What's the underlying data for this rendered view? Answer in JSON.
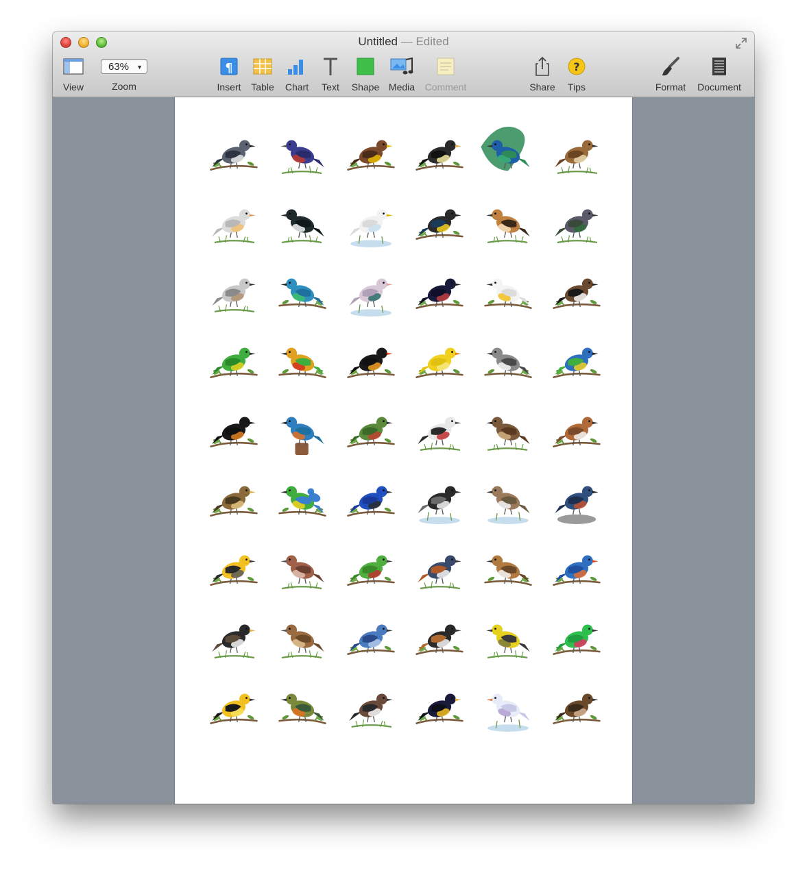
{
  "window": {
    "title": "Untitled",
    "title_status": "— Edited"
  },
  "toolbar": {
    "view_label": "View",
    "zoom_value": "63%",
    "zoom_label": "Zoom",
    "insert_label": "Insert",
    "table_label": "Table",
    "chart_label": "Chart",
    "text_label": "Text",
    "shape_label": "Shape",
    "media_label": "Media",
    "comment_label": "Comment",
    "share_label": "Share",
    "tips_label": "Tips",
    "format_label": "Format",
    "document_label": "Document"
  },
  "colors": {
    "canvas_background": "#8a929c",
    "accent_blue": "#3a8ee6",
    "table_yellow": "#f3c24a",
    "shape_green": "#3fbf4a",
    "tips_yellow": "#f5c518"
  },
  "birds": [
    {
      "body": "#5a6270",
      "wing": "#2d3340",
      "accent": "#e8e8e8",
      "beak": "#222",
      "perch": "branch"
    },
    {
      "body": "#3b3d8f",
      "wing": "#2a2b6a",
      "accent": "#c0392b",
      "beak": "#555",
      "perch": "ground"
    },
    {
      "body": "#7a4a2a",
      "wing": "#4a2c18",
      "accent": "#e6b800",
      "beak": "#e6b800",
      "perch": "branch"
    },
    {
      "body": "#2b2b2b",
      "wing": "#111111",
      "accent": "#f2e6a0",
      "beak": "#e0b040",
      "perch": "branch"
    },
    {
      "body": "#1e5fa8",
      "wing": "#2e8b57",
      "accent": "#3cb371",
      "beak": "#333",
      "perch": "peacock"
    },
    {
      "body": "#9a6b3a",
      "wing": "#6b4422",
      "accent": "#e8d8b0",
      "beak": "#333",
      "perch": "ground"
    },
    {
      "body": "#dcdcdc",
      "wing": "#b8b8b8",
      "accent": "#f0c070",
      "beak": "#e0a060",
      "perch": "ground"
    },
    {
      "body": "#1f2a2a",
      "wing": "#0f1818",
      "accent": "#f4f4f4",
      "beak": "#222",
      "perch": "grass"
    },
    {
      "body": "#f2f2f2",
      "wing": "#dadada",
      "accent": "#c8e0f0",
      "beak": "#e6b800",
      "perch": "water"
    },
    {
      "body": "#2a2a2a",
      "wing": "#1a3a5a",
      "accent": "#f2d020",
      "beak": "#222",
      "perch": "branch"
    },
    {
      "body": "#c08040",
      "wing": "#3a2a1a",
      "accent": "#f4e0c0",
      "beak": "#333",
      "perch": "grass"
    },
    {
      "body": "#5a5a6a",
      "wing": "#3a4a3a",
      "accent": "#2e6b3a",
      "beak": "#333",
      "perch": "ground"
    },
    {
      "body": "#c8c8c8",
      "wing": "#8a8a8a",
      "accent": "#b09070",
      "beak": "#333",
      "perch": "ground"
    },
    {
      "body": "#2f8fbf",
      "wing": "#1f6f9f",
      "accent": "#3cbf6a",
      "beak": "#222",
      "perch": "branch"
    },
    {
      "body": "#d8c8d8",
      "wing": "#b0a0b8",
      "accent": "#2f6f6a",
      "beak": "#e0a0a0",
      "perch": "water"
    },
    {
      "body": "#1a1a3a",
      "wing": "#0f0f2a",
      "accent": "#c04040",
      "beak": "#222",
      "perch": "branch"
    },
    {
      "body": "#f4f4f4",
      "wing": "#dcdcdc",
      "accent": "#f2c020",
      "beak": "#333",
      "perch": "branch"
    },
    {
      "body": "#6a4a30",
      "wing": "#1a1a1a",
      "accent": "#f4f4f4",
      "beak": "#222",
      "perch": "branch"
    },
    {
      "body": "#3fae3f",
      "wing": "#2a8a2a",
      "accent": "#e6d020",
      "beak": "#333",
      "perch": "branch"
    },
    {
      "body": "#e0a020",
      "wing": "#3fae3f",
      "accent": "#d03020",
      "beak": "#333",
      "perch": "branch"
    },
    {
      "body": "#1a1a1a",
      "wing": "#111111",
      "accent": "#f2a020",
      "beak": "#e04020",
      "perch": "branch"
    },
    {
      "body": "#f2d020",
      "wing": "#e0c010",
      "accent": "#f4e880",
      "beak": "#e08020",
      "perch": "branch"
    },
    {
      "body": "#8a8a8a",
      "wing": "#4a4a4a",
      "accent": "#f4f4f4",
      "beak": "#333",
      "perch": "branch"
    },
    {
      "body": "#2f6fbf",
      "wing": "#3fae3f",
      "accent": "#f2d020",
      "beak": "#222",
      "perch": "branch"
    },
    {
      "body": "#1a1a1a",
      "wing": "#111111",
      "accent": "#e08020",
      "beak": "#222",
      "perch": "branch"
    },
    {
      "body": "#2f7fbf",
      "wing": "#1f6fa0",
      "accent": "#e07020",
      "beak": "#222",
      "perch": "stump"
    },
    {
      "body": "#5a8a3a",
      "wing": "#3a6a2a",
      "accent": "#c04030",
      "beak": "#333",
      "perch": "branch"
    },
    {
      "body": "#e8e8e8",
      "wing": "#2a2a2a",
      "accent": "#c03030",
      "beak": "#555",
      "perch": "grass"
    },
    {
      "body": "#7a5a3a",
      "wing": "#5a3a20",
      "accent": "#d0b080",
      "beak": "#222",
      "perch": "ground"
    },
    {
      "body": "#b06a3a",
      "wing": "#7a4a2a",
      "accent": "#f4f4f4",
      "beak": "#333",
      "perch": "branch"
    },
    {
      "body": "#8a6a3a",
      "wing": "#4a3a20",
      "accent": "#e0c080",
      "beak": "#e0b040",
      "perch": "branch"
    },
    {
      "body": "#3fae3f",
      "wing": "#3a7fd0",
      "accent": "#f2d020",
      "beak": "#333",
      "perch": "pair"
    },
    {
      "body": "#1f4fbf",
      "wing": "#1a3a9a",
      "accent": "#2a2a2a",
      "beak": "#333",
      "perch": "branch"
    },
    {
      "body": "#2a2a2a",
      "wing": "#6a6a6a",
      "accent": "#f4f4f4",
      "beak": "#333",
      "perch": "water"
    },
    {
      "body": "#9a7a5a",
      "wing": "#6a5a40",
      "accent": "#f4f4f4",
      "beak": "#333",
      "perch": "water"
    },
    {
      "body": "#2f4f7f",
      "wing": "#1f2f4f",
      "accent": "#c05030",
      "beak": "#222",
      "perch": "rock"
    },
    {
      "body": "#f2c020",
      "wing": "#2a2a2a",
      "accent": "#5a5a5a",
      "beak": "#333",
      "perch": "branch"
    },
    {
      "body": "#a0604a",
      "wing": "#6a4030",
      "accent": "#e0c0b0",
      "beak": "#555",
      "perch": "ground"
    },
    {
      "body": "#4fae3f",
      "wing": "#3a8a2a",
      "accent": "#c03030",
      "beak": "#333",
      "perch": "branch"
    },
    {
      "body": "#3a4a6a",
      "wing": "#b05a2a",
      "accent": "#f4f4f4",
      "beak": "#333",
      "perch": "grass"
    },
    {
      "body": "#b07a40",
      "wing": "#6a4a2a",
      "accent": "#f4f4f4",
      "beak": "#333",
      "perch": "branch"
    },
    {
      "body": "#2f6fbf",
      "wing": "#1f4f9f",
      "accent": "#e07030",
      "beak": "#e04020",
      "perch": "branch"
    },
    {
      "body": "#2a2a2a",
      "wing": "#5a4a3a",
      "accent": "#f4f4f4",
      "beak": "#e0b040",
      "perch": "grass"
    },
    {
      "body": "#9a6a40",
      "wing": "#6a4a2a",
      "accent": "#e0c090",
      "beak": "#555",
      "perch": "ground"
    },
    {
      "body": "#4a7abf",
      "wing": "#2a4a8a",
      "accent": "#b0c8e8",
      "beak": "#333",
      "perch": "branch"
    },
    {
      "body": "#2a2a2a",
      "wing": "#b06a30",
      "accent": "#f4f4f4",
      "beak": "#333",
      "perch": "branch"
    },
    {
      "body": "#e6d020",
      "wing": "#3a3a3a",
      "accent": "#7a7a3a",
      "beak": "#333",
      "perch": "ground"
    },
    {
      "body": "#2fbf4f",
      "wing": "#1f9f3f",
      "accent": "#e03060",
      "beak": "#333",
      "perch": "branch"
    },
    {
      "body": "#f2c020",
      "wing": "#1a1a1a",
      "accent": "#f4e060",
      "beak": "#333",
      "perch": "branch"
    },
    {
      "body": "#7a8a3a",
      "wing": "#3a5a3a",
      "accent": "#e07020",
      "beak": "#333",
      "perch": "branch"
    },
    {
      "body": "#6a4a3a",
      "wing": "#2a2a2a",
      "accent": "#f4f4f4",
      "beak": "#333",
      "perch": "ground"
    },
    {
      "body": "#1a1a3a",
      "wing": "#0f0f1a",
      "accent": "#f2c020",
      "beak": "#e0b040",
      "perch": "branch"
    },
    {
      "body": "#e8ecf8",
      "wing": "#c8c8e8",
      "accent": "#b0a0d0",
      "beak": "#e08050",
      "perch": "water"
    },
    {
      "body": "#6a4a2a",
      "wing": "#3a2a1a",
      "accent": "#d0b090",
      "beak": "#333",
      "perch": "branch"
    }
  ]
}
